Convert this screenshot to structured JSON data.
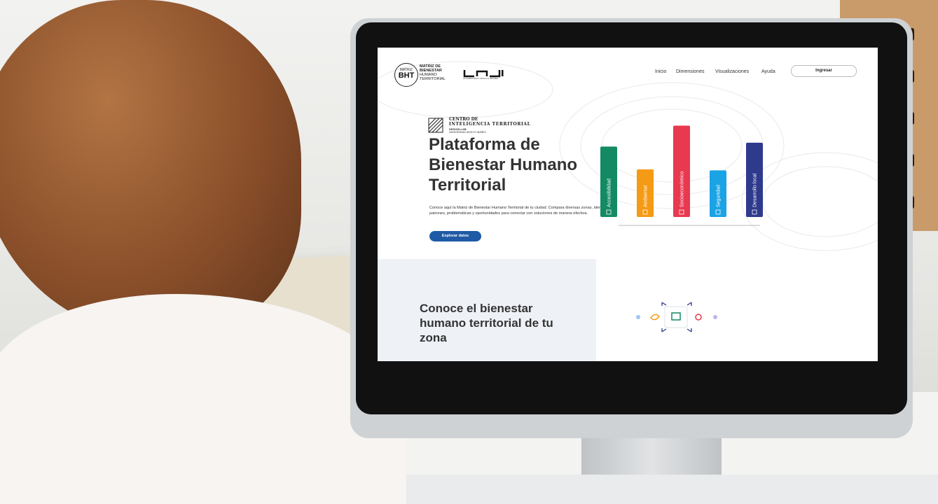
{
  "site": {
    "logo": {
      "bht_mark_top": "MATRIZ",
      "bht_mark_main": "BHT",
      "bht_text_lines": [
        "MATRIZ DE",
        "BIENESTAR",
        "HUMANO",
        "TERRITORIAL"
      ],
      "uai_subtext": "UNIVERSIDAD ADOLFO IBÁÑEZ"
    },
    "nav": {
      "links": [
        "Inicio",
        "Dimensiones",
        "Visualizaciones",
        "Ayuda"
      ],
      "login_label": "Ingresar"
    },
    "cit": {
      "line1": "CENTRO DE",
      "line2": "INTELIGENCIA TERRITORIAL",
      "line3": "DESIGN.LAB",
      "line4": "UNIVERSIDAD ADOLFO IBÁÑEZ"
    },
    "hero": {
      "title": "Plataforma de Bienestar Humano Territorial",
      "description": "Conoce aquí la Matriz de Bienestar Humano Territorial de tu ciudad. Compara diversas zonas, identifica patrones, problemáticas y oportunidades para conectar con soluciones de manera efectiva.",
      "cta_label": "Explorar datos"
    },
    "chart_data": {
      "type": "bar",
      "categories": [
        "Accesibilidad",
        "Ambiental",
        "Socioeconómico",
        "Seguridad",
        "Desarrollo local"
      ],
      "values": [
        0.74,
        0.5,
        0.96,
        0.49,
        0.78
      ],
      "colors": [
        "#138a63",
        "#f59a14",
        "#e8394f",
        "#1aa3e5",
        "#2e3a8c"
      ],
      "icons": [
        "building-icon",
        "leaf-icon",
        "money-icon",
        "lock-icon",
        "pin-icon"
      ]
    },
    "section2": {
      "title": "Conoce el bienestar humano territorial de tu zona"
    },
    "colors": {
      "primary": "#1f5aa6",
      "section_bg": "#eef1f6"
    }
  }
}
